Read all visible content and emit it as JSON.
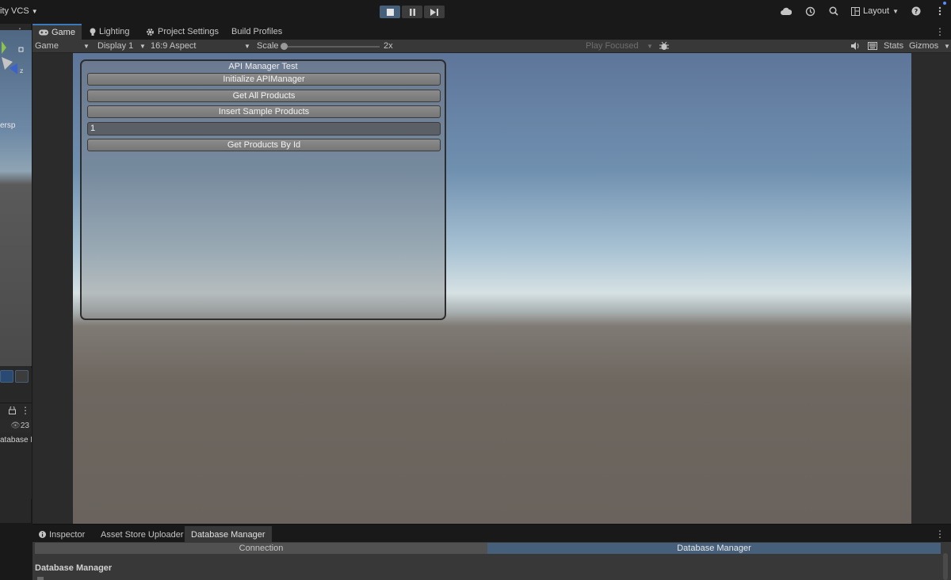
{
  "toolbar": {
    "vcs_label": "ity VCS",
    "layout_label": "Layout",
    "play_buttons": [
      "stop",
      "pause",
      "step"
    ]
  },
  "left_panel": {
    "toolrow_value": "1",
    "persp_label": "ersp",
    "visible_count": "23",
    "item_label": "atabase M"
  },
  "game_tabs": [
    {
      "label": "Game",
      "icon": "gamepad-icon"
    },
    {
      "label": "Lighting",
      "icon": "lightbulb-icon"
    },
    {
      "label": "Project Settings",
      "icon": "gear-icon"
    },
    {
      "label": "Build Profiles",
      "icon": ""
    }
  ],
  "game_toolbar": {
    "mode": "Game",
    "display": "Display 1",
    "aspect": "16:9 Aspect",
    "scale_label": "Scale",
    "scale_value": "2x",
    "play_mode": "Play Focused",
    "stats": "Stats",
    "gizmos": "Gizmos"
  },
  "gui": {
    "title": "API Manager Test",
    "buttons": [
      "Initialize APIManager",
      "Get All Products",
      "Insert Sample Products"
    ],
    "input_value": "1",
    "button_after_input": "Get Products By Id"
  },
  "bottom_tabs": [
    {
      "label": "Inspector",
      "icon": "info-icon"
    },
    {
      "label": "Asset Store Uploader",
      "icon": ""
    },
    {
      "label": "Database Manager",
      "icon": ""
    }
  ],
  "bottom_panel": {
    "segments": [
      "Connection",
      "Database Manager"
    ],
    "section_title": "Database Manager"
  },
  "colors": {
    "accent": "#46607c",
    "tab_highlight": "#3a79bb",
    "editor_bg": "#383838"
  }
}
